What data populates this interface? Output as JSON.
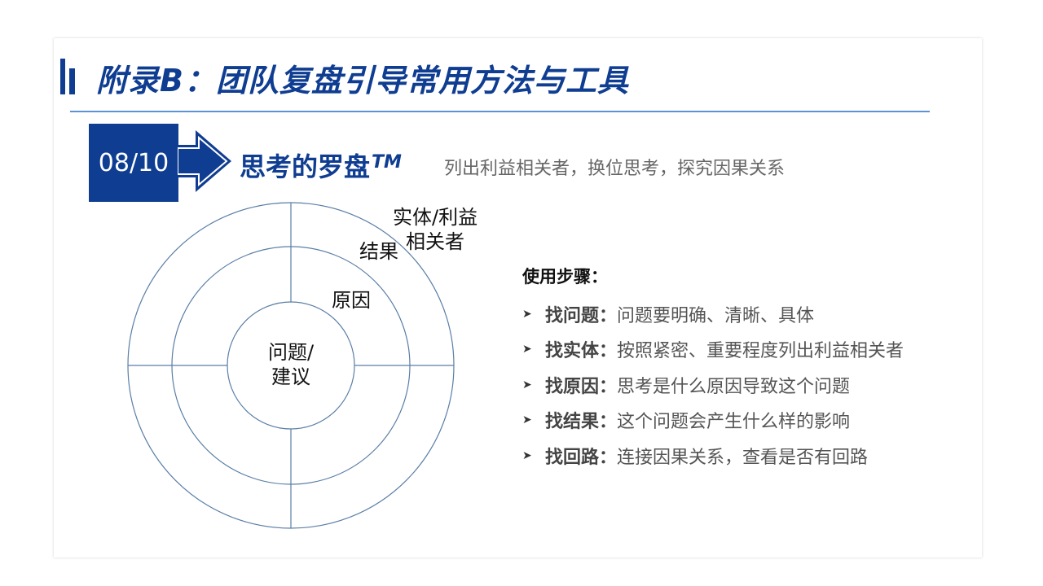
{
  "page": {
    "title": "附录B：团队复盘引导常用方法与工具"
  },
  "section": {
    "number": "08/10",
    "heading": "思考的罗盘",
    "trademark": "TM",
    "subtitle": "列出利益相关者，换位思考，探究因果关系"
  },
  "compass": {
    "center_line1": "问题/",
    "center_line2": "建议",
    "inner_ring": "原因",
    "middle_ring": "结果",
    "outer_ring_line1": "实体/利益",
    "outer_ring_line2": "相关者"
  },
  "steps": {
    "title": "使用步骤：",
    "items": [
      {
        "label": "找问题：",
        "text": "问题要明确、清晰、具体"
      },
      {
        "label": "找实体：",
        "text": "按照紧密、重要程度列出利益相关者"
      },
      {
        "label": "找原因：",
        "text": "思考是什么原因导致这个问题"
      },
      {
        "label": "找结果：",
        "text": "这个问题会产生什么样的影响"
      },
      {
        "label": "找回路：",
        "text": "连接因果关系，查看是否有回路"
      }
    ]
  },
  "colors": {
    "brand_blue": "#0f3d91",
    "rule_blue": "#5b93d6",
    "ring_stroke": "#5a7ea6",
    "text_gray": "#555555"
  },
  "icons": {
    "step_bullet": "arrowhead-bullet-icon",
    "section_arrow": "right-arrow-icon"
  }
}
